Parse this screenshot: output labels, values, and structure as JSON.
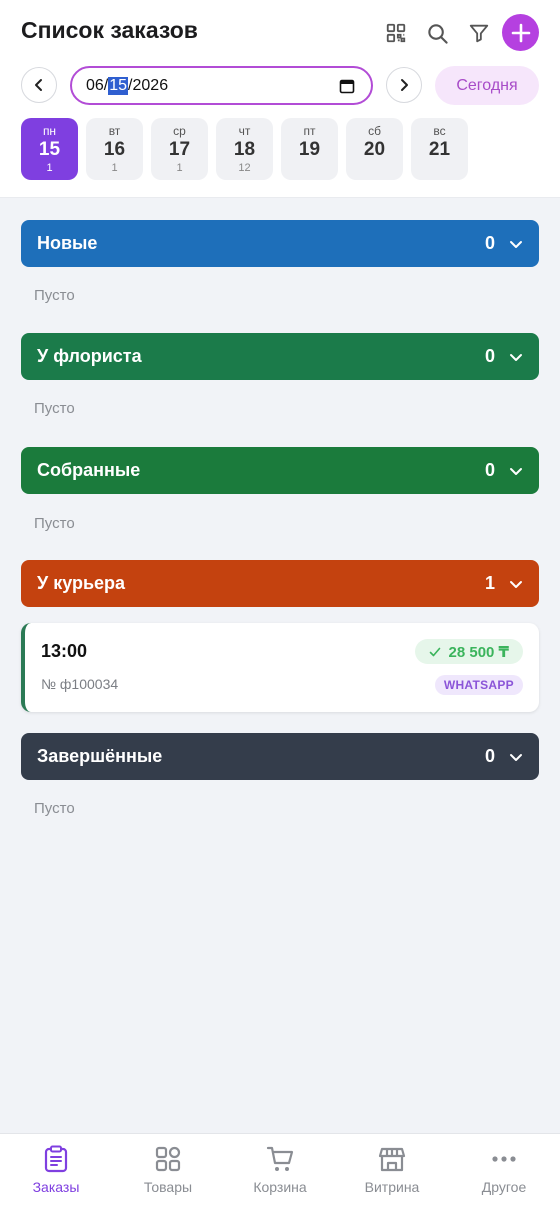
{
  "header": {
    "title": "Список заказов"
  },
  "date_bar": {
    "date_month": "06",
    "date_day": "15",
    "date_year": "2026",
    "today_label": "Сегодня"
  },
  "days": [
    {
      "name": "пн",
      "date": "15",
      "count": "1",
      "active": true
    },
    {
      "name": "вт",
      "date": "16",
      "count": "1"
    },
    {
      "name": "ср",
      "date": "17",
      "count": "1"
    },
    {
      "name": "чт",
      "date": "18",
      "count": "12"
    },
    {
      "name": "пт",
      "date": "19",
      "count": ""
    },
    {
      "name": "сб",
      "date": "20",
      "count": ""
    },
    {
      "name": "вс",
      "date": "21",
      "count": ""
    }
  ],
  "groups": [
    {
      "name": "Новые",
      "count": "0",
      "color": "#1e6fba",
      "empty": "Пусто"
    },
    {
      "name": "У флориста",
      "count": "0",
      "color": "#1b7b4a",
      "empty": "Пусто"
    },
    {
      "name": "Собранные",
      "count": "0",
      "color": "#1b7b3c",
      "empty": "Пусто"
    },
    {
      "name": "У курьера",
      "count": "1",
      "color": "#c4420f"
    },
    {
      "name": "Завершённые",
      "count": "0",
      "color": "#343d4b",
      "empty": "Пусто"
    }
  ],
  "order": {
    "time": "13:00",
    "number": "№ ф100034",
    "price": "28 500 ₸",
    "source": "WHATSAPP"
  },
  "bottom_nav": [
    {
      "label": "Заказы",
      "icon": "clipboard-icon",
      "active": true
    },
    {
      "label": "Товары",
      "icon": "grid-icon"
    },
    {
      "label": "Корзина",
      "icon": "cart-icon"
    },
    {
      "label": "Витрина",
      "icon": "store-icon"
    },
    {
      "label": "Другое",
      "icon": "more-icon"
    }
  ],
  "colors": {
    "accent": "#7f3fe0",
    "add_button": "#b540e0"
  }
}
